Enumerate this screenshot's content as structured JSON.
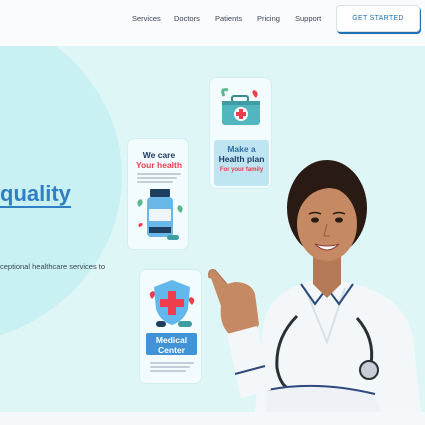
{
  "nav": {
    "items": [
      "Services",
      "Doctors",
      "Patients",
      "Pricing",
      "Support"
    ],
    "cta_label": "GET STARTED"
  },
  "hero": {
    "headline": "quality",
    "subtext": "ceptional healthcare services to"
  },
  "cards": {
    "care": {
      "line1": "We care",
      "line2": "Your health"
    },
    "plan": {
      "line1": "Make a",
      "line2": "Health plan",
      "line3": "For your family"
    },
    "center": {
      "line1": "Medical",
      "line2": "Center"
    }
  },
  "colors": {
    "accent": "#2e7fc4",
    "red": "#ee3d4f",
    "teal": "#51b6bd",
    "hero_bg": "#dff6f7"
  }
}
